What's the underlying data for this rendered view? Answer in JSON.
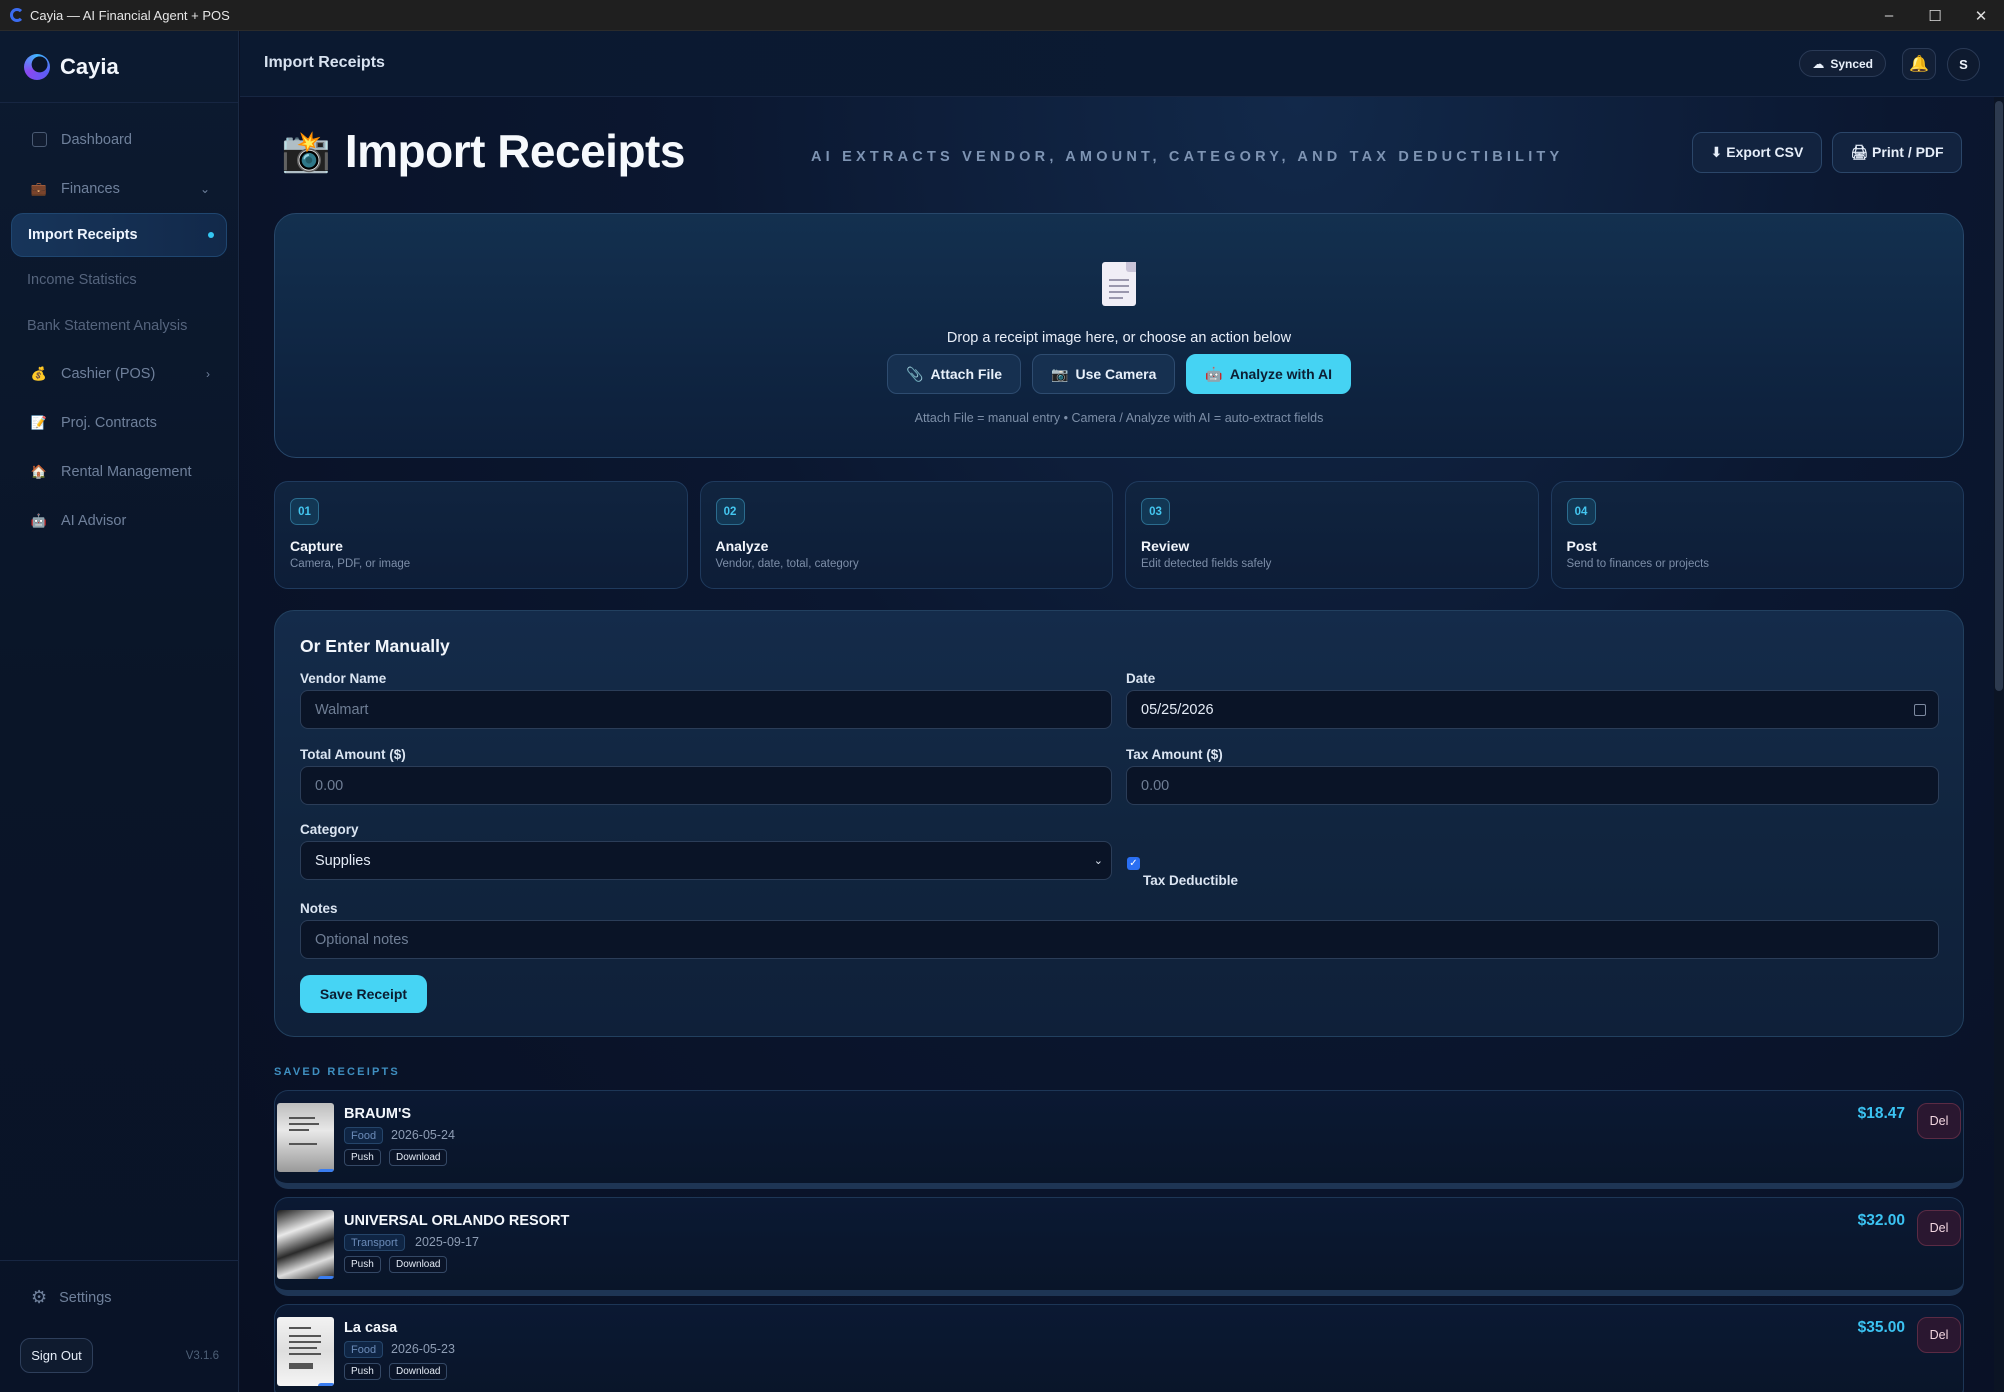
{
  "window": {
    "title": "Cayia — AI Financial Agent + POS",
    "controls": [
      "–",
      "☐",
      "✕"
    ]
  },
  "brand": {
    "name": "Cayia",
    "accent": "#46d4f4"
  },
  "sidebar": {
    "items": [
      {
        "label": "Dashboard",
        "icon": "dashboard-icon"
      },
      {
        "label": "Finances",
        "icon": "briefcase-icon",
        "chevron": "⌄"
      },
      {
        "label": "Import Receipts",
        "active": true
      },
      {
        "label": "Income Statistics"
      },
      {
        "label": "Bank Statement Analysis"
      },
      {
        "label": "Cashier (POS)",
        "icon": "moneybag-icon",
        "chevron": "›"
      },
      {
        "label": "Proj. Contracts",
        "icon": "memo-icon"
      },
      {
        "label": "Rental Management",
        "icon": "house-icon"
      },
      {
        "label": "AI Advisor",
        "icon": "robot-icon"
      }
    ],
    "settings_label": "Settings",
    "signout_label": "Sign Out",
    "version": "V3.1.6"
  },
  "topbar": {
    "title": "Import Receipts",
    "sync_label": "Synced",
    "avatar_initial": "S"
  },
  "header": {
    "title": "Import Receipts",
    "subtitle": "AI EXTRACTS VENDOR, AMOUNT, CATEGORY, AND TAX DEDUCTIBILITY",
    "export_label": "⬇ Export CSV",
    "print_label": "🖨 Print / PDF"
  },
  "dropzone": {
    "prompt": "Drop a receipt image here, or choose an action below",
    "attach_label": "Attach File",
    "camera_label": "Use Camera",
    "analyze_label": "Analyze with AI",
    "hint": "Attach File = manual entry • Camera / Analyze with AI = auto-extract fields"
  },
  "steps": [
    {
      "num": "01",
      "title": "Capture",
      "desc": "Camera, PDF, or image"
    },
    {
      "num": "02",
      "title": "Analyze",
      "desc": "Vendor, date, total, category"
    },
    {
      "num": "03",
      "title": "Review",
      "desc": "Edit detected fields safely"
    },
    {
      "num": "04",
      "title": "Post",
      "desc": "Send to finances or projects"
    }
  ],
  "form": {
    "title": "Or Enter Manually",
    "vendor_label": "Vendor Name",
    "vendor_placeholder": "Walmart",
    "date_label": "Date",
    "date_value": "05/25/2026",
    "total_label": "Total Amount ($)",
    "total_placeholder": "0.00",
    "tax_label": "Tax Amount ($)",
    "tax_placeholder": "0.00",
    "category_label": "Category",
    "category_value": "Supplies",
    "tax_deductible_label": "Tax Deductible",
    "tax_deductible_checked": true,
    "notes_label": "Notes",
    "notes_placeholder": "Optional notes",
    "save_label": "Save Receipt"
  },
  "saved": {
    "label": "SAVED RECEIPTS",
    "push_label": "Push",
    "download_label": "Download",
    "delete_label": "Del",
    "receipts": [
      {
        "vendor": "BRAUM'S",
        "category": "Food",
        "date": "2026-05-24",
        "amount": "$18.47"
      },
      {
        "vendor": "UNIVERSAL ORLANDO RESORT",
        "category": "Transport",
        "date": "2025-09-17",
        "amount": "$32.00"
      },
      {
        "vendor": "La casa",
        "category": "Food",
        "date": "2026-05-23",
        "amount": "$35.00"
      }
    ]
  }
}
